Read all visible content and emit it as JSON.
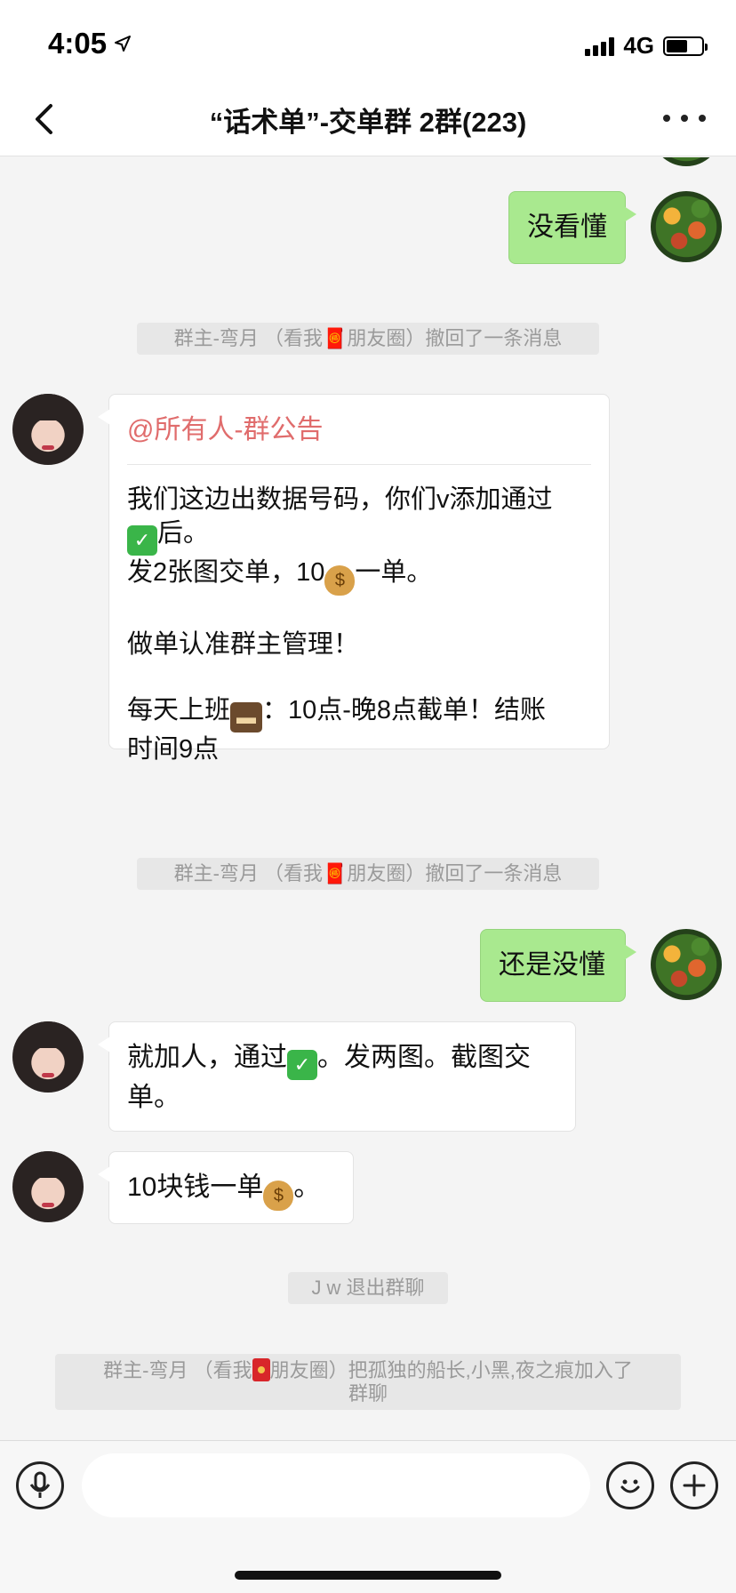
{
  "status_bar": {
    "time": "4:05",
    "network": "4G"
  },
  "nav": {
    "title": "“话术单”-交单群 2群(223)"
  },
  "messages": {
    "mine_1": "没看懂",
    "recall_1": "群主-弯月 （看我🧧朋友圈）撤回了一条消息",
    "announce": {
      "header": "@所有人-群公告",
      "line1_a": "我们这边出数据号码，你们v添加通过",
      "line1_b": "后。",
      "line2_a": "发2张图交单，10",
      "line2_b": "一单。",
      "line3": "做单认准群主管理！",
      "line4_a": "每天上班",
      "line4_b": "：10点-晚8点截单！结账",
      "line4_c": "时间9点"
    },
    "recall_2": "群主-弯月 （看我🧧朋友圈）撤回了一条消息",
    "mine_2": "还是没懂",
    "theirs_1_a": "就加人，通过",
    "theirs_1_b": "。发两图。截图交",
    "theirs_1_c": "单。",
    "theirs_2_a": "10块钱一单",
    "theirs_2_b": "。",
    "exit": "J w 退出群聊",
    "join_a": "群主-弯月 （看我",
    "join_b": "朋友圈）把孤独的船长,小黑,夜之痕加入了",
    "join_c": "群聊"
  },
  "icons": {
    "check": "✓",
    "money": "$",
    "briefcase": "▬"
  },
  "colors": {
    "my_bubble": "#a9e98f",
    "announce_header": "#e06c6c"
  }
}
